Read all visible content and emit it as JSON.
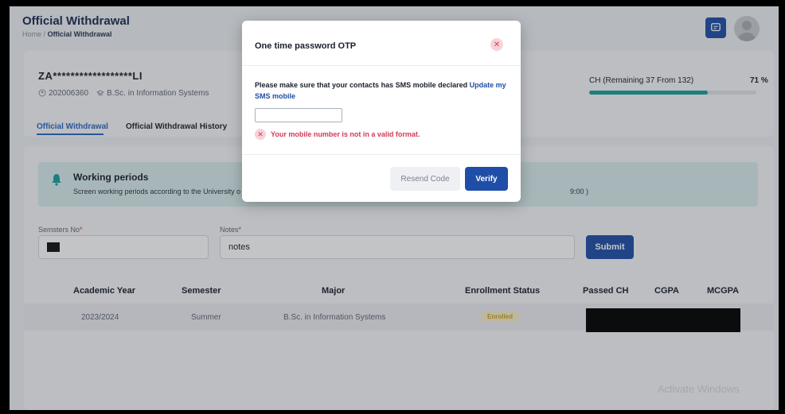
{
  "header": {
    "title": "Official Withdrawal",
    "breadcrumb_home": "Home",
    "breadcrumb_sep": "/",
    "breadcrumb_current": "Official Withdrawal"
  },
  "student": {
    "name": "ZA******************LI",
    "id": "202006360",
    "program": "B.Sc. in Information Systems"
  },
  "tabs": [
    {
      "label": "Official Withdrawal",
      "active": true
    },
    {
      "label": "Official Withdrawal History",
      "active": false
    }
  ],
  "credit_hours": {
    "label": "CH (Remaining 37 From 132)",
    "percent_label": "71 %",
    "percent": 71
  },
  "info": {
    "title": "Working periods",
    "text": "Screen working periods according to the University o",
    "tail": "9:00 )"
  },
  "form": {
    "semesters_label": "Semsters No",
    "notes_label": "Notes",
    "required_mark": "*",
    "notes_value": "notes",
    "submit_label": "Submit"
  },
  "table": {
    "headers": [
      "Academic Year",
      "Semester",
      "Major",
      "Enrollment Status",
      "Passed CH",
      "CGPA",
      "MCGPA"
    ],
    "rows": [
      {
        "year": "2023/2024",
        "semester": "Summer",
        "major": "B.Sc. in Information Systems",
        "status": "Enrolled"
      }
    ]
  },
  "watermark": "Activate Windows",
  "modal": {
    "title": "One time password OTP",
    "message": "Please make sure that your contacts has SMS mobile declared ",
    "link": "Update my SMS mobile",
    "error": "Your mobile number is not in a valid format.",
    "resend_label": "Resend Code",
    "verify_label": "Verify"
  },
  "colors": {
    "primary": "#1f4ea8",
    "accent_teal": "#17a09a",
    "error": "#d23b55"
  }
}
